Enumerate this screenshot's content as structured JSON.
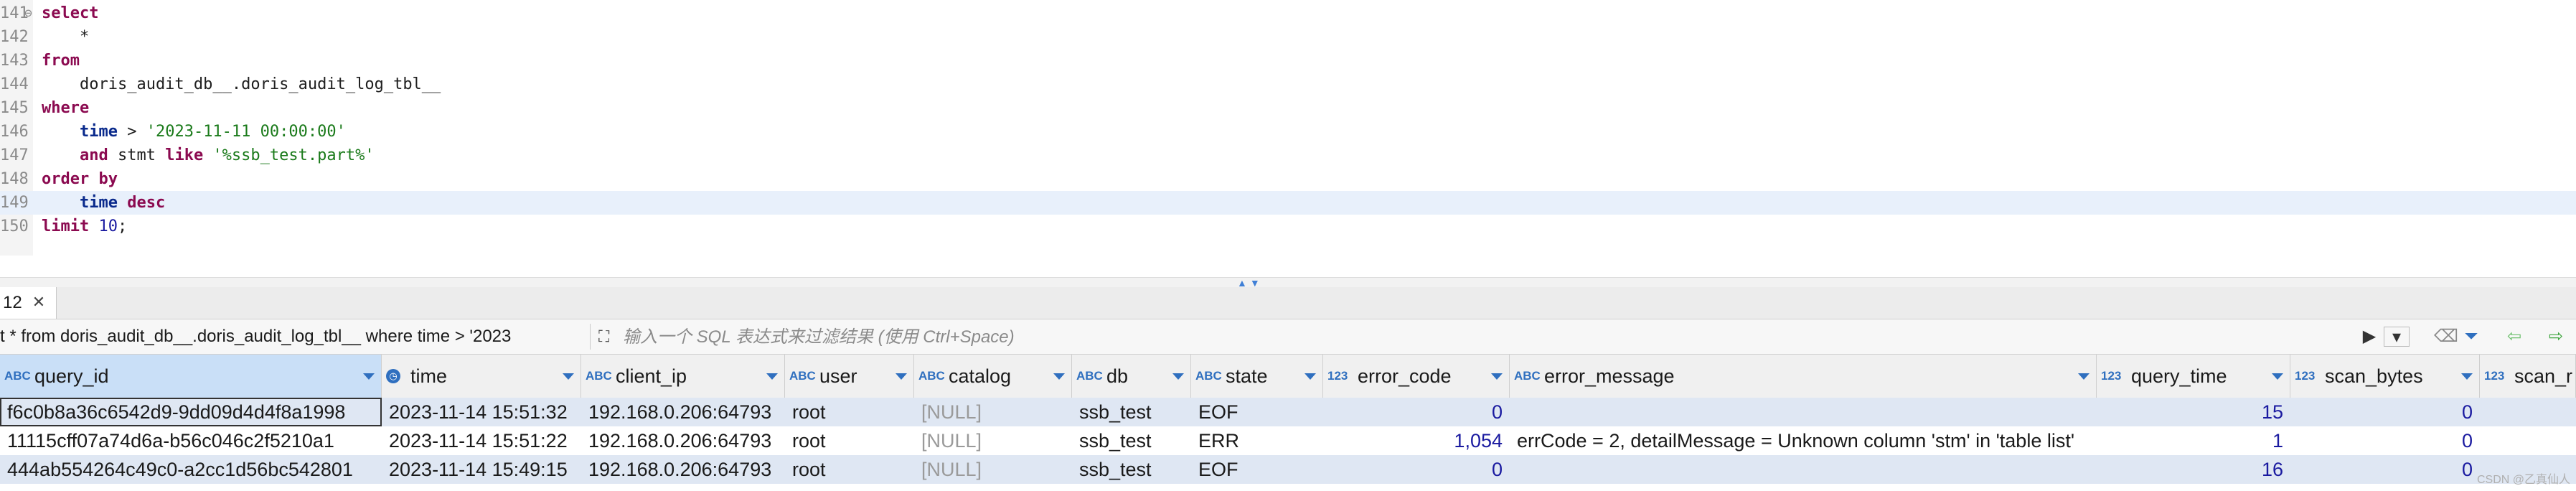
{
  "editor": {
    "lines": [
      {
        "no": "141",
        "fold": "⊖",
        "tokens": [
          {
            "t": "select",
            "c": "kw"
          }
        ]
      },
      {
        "no": "142",
        "tokens": [
          {
            "t": "    *",
            "c": "id"
          }
        ]
      },
      {
        "no": "143",
        "tokens": [
          {
            "t": "from",
            "c": "kw"
          }
        ]
      },
      {
        "no": "144",
        "tokens": [
          {
            "t": "    doris_audit_db__.doris_audit_log_tbl__",
            "c": "id"
          }
        ]
      },
      {
        "no": "145",
        "tokens": [
          {
            "t": "where",
            "c": "kw"
          }
        ]
      },
      {
        "no": "146",
        "tokens": [
          {
            "t": "    time",
            "c": "kw2"
          },
          {
            "t": " > ",
            "c": "id"
          },
          {
            "t": "'2023-11-11 00:00:00'",
            "c": "str"
          }
        ]
      },
      {
        "no": "147",
        "tokens": [
          {
            "t": "    and",
            "c": "kw"
          },
          {
            "t": " stmt ",
            "c": "id"
          },
          {
            "t": "like",
            "c": "kw"
          },
          {
            "t": " ",
            "c": "id"
          },
          {
            "t": "'%ssb_test.part%'",
            "c": "str"
          }
        ]
      },
      {
        "no": "148",
        "tokens": [
          {
            "t": "order by",
            "c": "kw"
          }
        ]
      },
      {
        "no": "149",
        "current": true,
        "tokens": [
          {
            "t": "    time",
            "c": "kw2"
          },
          {
            "t": " ",
            "c": "id"
          },
          {
            "t": "desc",
            "c": "kw"
          }
        ]
      },
      {
        "no": "150",
        "tokens": [
          {
            "t": "limit",
            "c": "kw"
          },
          {
            "t": " ",
            "c": "id"
          },
          {
            "t": "10",
            "c": "num"
          },
          {
            "t": ";",
            "c": "id"
          }
        ]
      }
    ]
  },
  "results_tab": {
    "label": "12",
    "close": "✕"
  },
  "filter": {
    "query_text": "t * from doris_audit_db__.doris_audit_log_tbl__ where time > '2023",
    "placeholder": "输入一个 SQL 表达式来过滤结果 (使用 Ctrl+Space)"
  },
  "columns": [
    {
      "label": "query_id",
      "type": "ABC"
    },
    {
      "label": "time",
      "type": "clock"
    },
    {
      "label": "client_ip",
      "type": "ABC"
    },
    {
      "label": "user",
      "type": "ABC"
    },
    {
      "label": "catalog",
      "type": "ABC"
    },
    {
      "label": "db",
      "type": "ABC"
    },
    {
      "label": "state",
      "type": "ABC"
    },
    {
      "label": "error_code",
      "type": "123"
    },
    {
      "label": "error_message",
      "type": "ABC"
    },
    {
      "label": "query_time",
      "type": "123"
    },
    {
      "label": "scan_bytes",
      "type": "123"
    },
    {
      "label": "scan_r",
      "type": "123"
    }
  ],
  "rows": [
    [
      "f6c0b8a36c6542d9-9dd09d4d4f8a1998",
      "2023-11-14 15:51:32",
      "192.168.0.206:64793",
      "root",
      "[NULL]",
      "ssb_test",
      "EOF",
      "0",
      "",
      "15",
      "0",
      ""
    ],
    [
      "11115cff07a74d6a-b56c046c2f5210a1",
      "2023-11-14 15:51:22",
      "192.168.0.206:64793",
      "root",
      "[NULL]",
      "ssb_test",
      "ERR",
      "1,054",
      "errCode = 2, detailMessage = Unknown column 'stm' in 'table list'",
      "1",
      "0",
      ""
    ],
    [
      "444ab554264c49c0-a2cc1d56bc542801",
      "2023-11-14 15:49:15",
      "192.168.0.206:64793",
      "root",
      "[NULL]",
      "ssb_test",
      "EOF",
      "0",
      "",
      "16",
      "0",
      ""
    ]
  ],
  "toolbar_icons": [
    "play-icon",
    "dropdown-icon",
    "eraser-icon",
    "filter-icon",
    "back-arrow-icon",
    "forward-arrow-icon"
  ],
  "watermark": "CSDN @乙真仙人",
  "colors": {
    "accent": "#2f6fbf",
    "keyword": "#8b0a50",
    "string": "#1a7a1a",
    "row_alt": "#dfe7f3",
    "selected_header": "#c9dff7"
  }
}
